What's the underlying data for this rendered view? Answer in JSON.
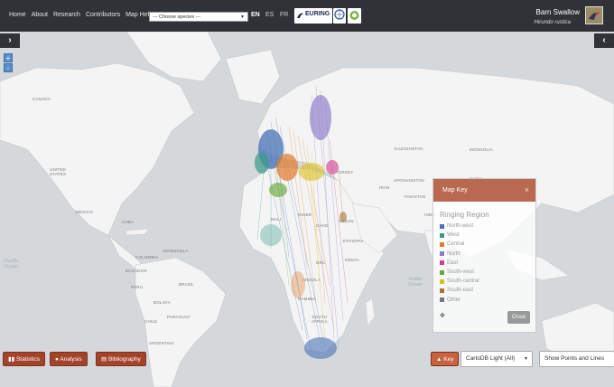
{
  "nav": {
    "links": [
      "Home",
      "About",
      "Research",
      "Contributors",
      "Map Help"
    ],
    "species_select": {
      "value": "--- Choose species ---"
    },
    "languages": [
      {
        "code": "EN",
        "active": true
      },
      {
        "code": "ES",
        "active": false
      },
      {
        "code": "FR",
        "active": false
      }
    ],
    "logo_text": "EURING"
  },
  "species": {
    "common_name": "Barn Swallow",
    "latin_name": "Hirundo rustica"
  },
  "map": {
    "zoom_in": "+",
    "zoom_out": "-",
    "left_toggle": "›",
    "right_toggle": "‹",
    "labels": {
      "canada": "CANADA",
      "us": "UNITED\nSTATES",
      "mexico": "MEXICO",
      "cuba": "CUBA",
      "pacific": "Pacific\nOcean",
      "colombia": "COLOMBIA",
      "venezuela": "VENEZUELA",
      "ecuador": "ECUADOR",
      "peru": "PERU",
      "brazil": "BRAZIL",
      "bolivia": "BOLIVIA",
      "chile": "CHILE",
      "paraguay": "PARAGUAY",
      "argentina": "ARGENTINA",
      "mali": "MALI",
      "niger": "NIGER",
      "chad": "CHAD",
      "sudan": "SUDAN",
      "ethiopia": "ETHIOPIA",
      "kenya": "KENYA",
      "drc": "DRC",
      "angola": "ANGOLA",
      "namibia": "NAMIBIA",
      "south_africa": "SOUTH\nAFRICA",
      "turkey": "TURKEY",
      "iran": "IRAN",
      "kazakhstan": "KAZAKHSTAN",
      "mongolia": "MONGOLIA",
      "china": "CHINA",
      "india": "INDIA",
      "pakistan": "PAKISTAN",
      "afghanistan": "AFGHANISTAN",
      "indian_ocean": "Indian\nOcean"
    }
  },
  "toolbar": {
    "statistics": "Statistics",
    "analysis": "Analysis",
    "bibliography": "Bibliography",
    "key": "Key",
    "basemap": "CartoDB Light (All)",
    "display_mode": "Show Points and Lines"
  },
  "key_panel": {
    "header": "Map Key",
    "close_x": "×",
    "title": "Ringing Region",
    "move_icon": "✥",
    "close_label": "Close",
    "items": [
      {
        "label": "North-west",
        "color": "#4a73b5"
      },
      {
        "label": "West",
        "color": "#3a9a8a"
      },
      {
        "label": "Central",
        "color": "#e07b2a"
      },
      {
        "label": "North",
        "color": "#8a78c8"
      },
      {
        "label": "East",
        "color": "#d23a8c"
      },
      {
        "label": "South-west",
        "color": "#68a83a"
      },
      {
        "label": "South-central",
        "color": "#d8c21e"
      },
      {
        "label": "South-east",
        "color": "#a8762e"
      },
      {
        "label": "Other",
        "color": "#777777"
      }
    ]
  }
}
